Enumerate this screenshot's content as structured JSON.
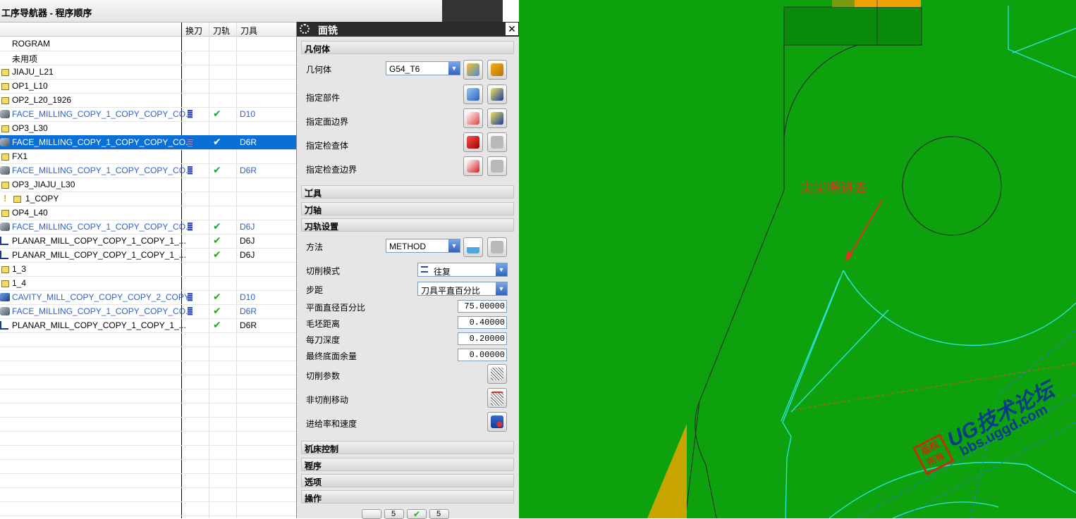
{
  "navigator": {
    "title": "工序导航器 - 程序顺序",
    "columns": [
      "换刀",
      "刀轨",
      "刀具"
    ],
    "rows": [
      {
        "name": "ROGRAM",
        "icon": "none-icon",
        "blue": false,
        "change": false,
        "path": false,
        "tool": ""
      },
      {
        "name": "未用项",
        "icon": "none-icon",
        "blue": false,
        "change": false,
        "path": false,
        "tool": ""
      },
      {
        "name": "JIAJU_L21",
        "icon": "folder-icon",
        "blue": false,
        "change": false,
        "path": false,
        "tool": ""
      },
      {
        "name": "OP1_L10",
        "icon": "folder-icon",
        "blue": false,
        "change": false,
        "path": false,
        "tool": ""
      },
      {
        "name": "OP2_L20_1926",
        "icon": "folder-icon",
        "blue": false,
        "change": false,
        "path": false,
        "tool": ""
      },
      {
        "name": "FACE_MILLING_COPY_1_COPY_COPY_CO...",
        "icon": "face-mill-icon",
        "blue": true,
        "change": true,
        "path": true,
        "tool": "D10"
      },
      {
        "name": "OP3_L30",
        "icon": "folder-icon",
        "blue": false,
        "change": false,
        "path": false,
        "tool": ""
      },
      {
        "name": "FACE_MILLING_COPY_1_COPY_COPY_CO...",
        "icon": "face-mill-icon",
        "blue": false,
        "change": true,
        "path": true,
        "tool": "D6R",
        "selected": true
      },
      {
        "name": "FX1",
        "icon": "folder-icon",
        "blue": false,
        "change": false,
        "path": false,
        "tool": ""
      },
      {
        "name": "FACE_MILLING_COPY_1_COPY_COPY_CO...",
        "icon": "face-mill-icon",
        "blue": true,
        "change": true,
        "path": true,
        "tool": "D6R"
      },
      {
        "name": "OP3_JIAJU_L30",
        "icon": "folder-icon",
        "blue": false,
        "change": false,
        "path": false,
        "tool": ""
      },
      {
        "name": "1_COPY",
        "icon": "warning-folder-icon",
        "blue": false,
        "change": false,
        "path": false,
        "tool": ""
      },
      {
        "name": "OP4_L40",
        "icon": "folder-icon",
        "blue": false,
        "change": false,
        "path": false,
        "tool": ""
      },
      {
        "name": "FACE_MILLING_COPY_1_COPY_COPY_CO...",
        "icon": "face-mill-icon",
        "blue": true,
        "change": true,
        "path": true,
        "tool": "D6J"
      },
      {
        "name": "PLANAR_MILL_COPY_COPY_1_COPY_1_...",
        "icon": "planar-mill-icon",
        "blue": false,
        "change": false,
        "path": true,
        "tool": "D6J"
      },
      {
        "name": "PLANAR_MILL_COPY_COPY_1_COPY_1_...",
        "icon": "planar-mill-icon",
        "blue": false,
        "change": false,
        "path": true,
        "tool": "D6J"
      },
      {
        "name": "1_3",
        "icon": "folder-icon",
        "blue": false,
        "change": false,
        "path": false,
        "tool": ""
      },
      {
        "name": "1_4",
        "icon": "folder-icon",
        "blue": false,
        "change": false,
        "path": false,
        "tool": ""
      },
      {
        "name": "CAVITY_MILL_COPY_COPY_COPY_2_COPY",
        "icon": "cavity-mill-icon",
        "blue": true,
        "change": true,
        "path": true,
        "tool": "D10"
      },
      {
        "name": "FACE_MILLING_COPY_1_COPY_COPY_CO...",
        "icon": "face-mill-icon",
        "blue": true,
        "change": true,
        "path": true,
        "tool": "D6R"
      },
      {
        "name": "PLANAR_MILL_COPY_COPY_1_COPY_1_...",
        "icon": "planar-mill-icon",
        "blue": false,
        "change": false,
        "path": true,
        "tool": "D6R"
      }
    ]
  },
  "dialog": {
    "title": "面铣",
    "close_symbol": "✕",
    "sections": {
      "geometry": "几何体",
      "tool": "工具",
      "axis": "刀轴",
      "path_settings": "刀轨设置",
      "machine_control": "机床控制",
      "program": "程序",
      "options": "选项",
      "actions": "操作"
    },
    "geometry": {
      "label": "几何体",
      "value": "G54_T6",
      "specify_part": "指定部件",
      "specify_face_boundary": "指定面边界",
      "specify_check_body": "指定检查体",
      "specify_check_boundary": "指定检查边界"
    },
    "path": {
      "method_label": "方法",
      "method_value": "METHOD",
      "cut_pattern_label": "切削模式",
      "cut_pattern_value": "往复",
      "stepover_label": "步距",
      "stepover_value": "刀具平直百分比",
      "flat_diameter_label": "平面直径百分比",
      "flat_diameter_value": "75.00000",
      "blank_distance_label": "毛坯距离",
      "blank_distance_value": "0.40000",
      "depth_per_cut_label": "每刀深度",
      "depth_per_cut_value": "0.20000",
      "final_floor_stock_label": "最终底面余量",
      "final_floor_stock_value": "0.00000",
      "cutting_params_label": "切削参数",
      "non_cutting_label": "非切削移动",
      "feeds_label": "进给率和速度"
    },
    "action_buttons": [
      "5",
      "5"
    ]
  },
  "graphics": {
    "annotation": "尖尖嘴进去",
    "watermark_main": "UG技术论坛",
    "watermark_url": "bbs.uggd.com",
    "stamp": "版权所有"
  },
  "colors": {
    "model_green": "#0da20d",
    "edge_cyan": "#2fe6e6",
    "annotation_red": "#e03020",
    "selection_blue": "#0a6fd6"
  }
}
